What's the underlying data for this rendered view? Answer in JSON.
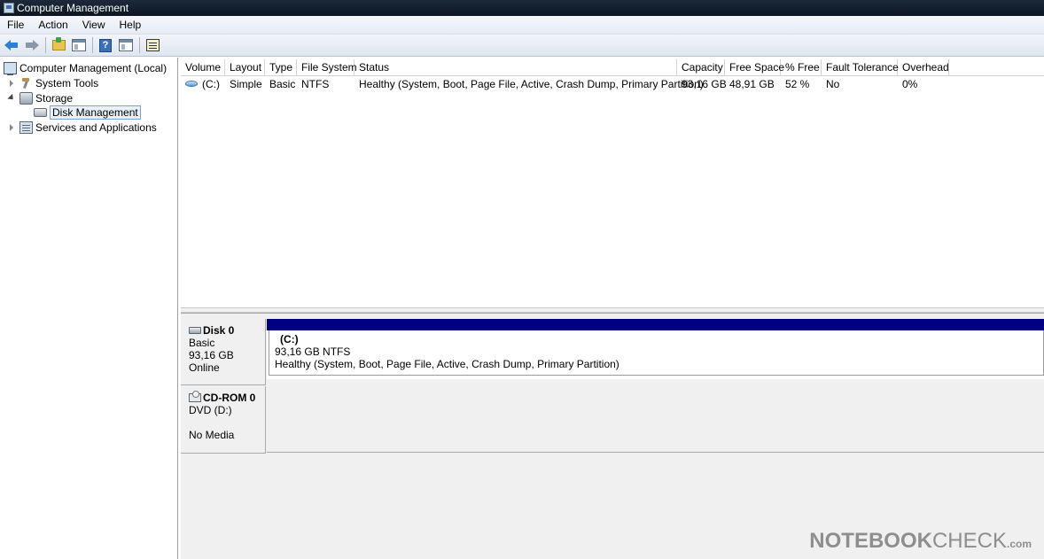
{
  "window": {
    "title": "Computer Management"
  },
  "menu": [
    "File",
    "Action",
    "View",
    "Help"
  ],
  "toolbar": {
    "buttons": [
      "back-icon",
      "forward-icon",
      "up-folder-icon",
      "show-hide-console-tree-icon",
      "help-icon",
      "show-hide-action-pane-icon",
      "properties-icon"
    ]
  },
  "tree": {
    "root": "Computer Management (Local)",
    "items": [
      {
        "label": "System Tools",
        "state": "collapsed"
      },
      {
        "label": "Storage",
        "state": "expanded"
      },
      {
        "label": "Disk Management",
        "state": "selected"
      },
      {
        "label": "Services and Applications",
        "state": "collapsed"
      }
    ]
  },
  "volumes": {
    "columns": [
      "Volume",
      "Layout",
      "Type",
      "File System",
      "Status",
      "Capacity",
      "Free Space",
      "% Free",
      "Fault Tolerance",
      "Overhead"
    ],
    "rows": [
      {
        "volume": "(C:)",
        "layout": "Simple",
        "type": "Basic",
        "fs": "NTFS",
        "status": "Healthy (System, Boot, Page File, Active, Crash Dump, Primary Partition)",
        "capacity": "93,16 GB",
        "free": "48,91 GB",
        "pct_free": "52 %",
        "fault": "No",
        "overhead": "0%"
      }
    ]
  },
  "disks": [
    {
      "name": "Disk 0",
      "type": "Basic",
      "size": "93,16 GB",
      "state": "Online",
      "partition": {
        "name": "(C:)",
        "size_fs": "93,16 GB NTFS",
        "status": "Healthy (System, Boot, Page File, Active, Crash Dump, Primary Partition)",
        "color": "#000080"
      }
    },
    {
      "name": "CD-ROM 0",
      "type": "DVD (D:)",
      "media": "No Media"
    }
  ],
  "watermark": {
    "main": "NOTEBOOK",
    "thin": "CHECK",
    "suffix": ".com"
  }
}
